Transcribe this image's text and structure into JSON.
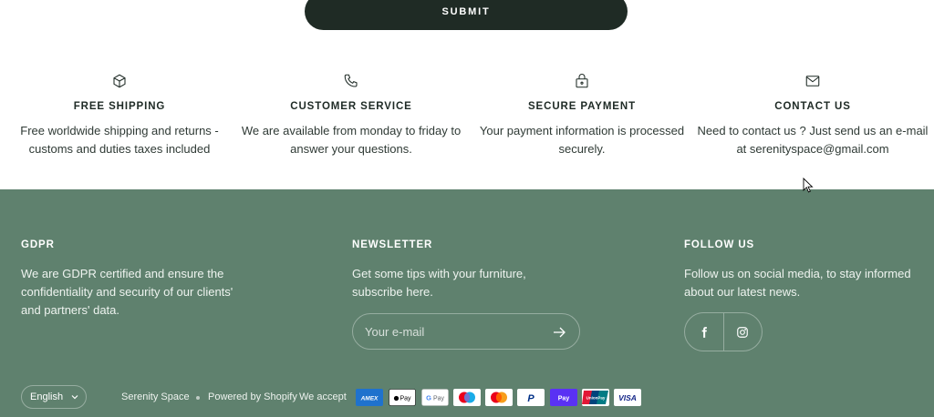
{
  "form": {
    "submit_label": "SUBMIT"
  },
  "features": [
    {
      "icon": "package-icon",
      "title": "FREE SHIPPING",
      "text": "Free worldwide shipping and returns - customs and duties taxes included"
    },
    {
      "icon": "phone-icon",
      "title": "CUSTOMER SERVICE",
      "text": "We are available from monday to friday to answer your questions."
    },
    {
      "icon": "lock-icon",
      "title": "SECURE PAYMENT",
      "text": "Your payment information is processed securely."
    },
    {
      "icon": "mail-icon",
      "title": "CONTACT US",
      "text": "Need to contact us ? Just send us an e-mail at serenityspace@gmail.com"
    }
  ],
  "footer": {
    "background": "#5f816e",
    "gdpr": {
      "title": "GDPR",
      "text": "We are GDPR certified and ensure the confidentiality and security of our clients' and partners' data."
    },
    "newsletter": {
      "title": "NEWSLETTER",
      "text": "Get some tips with your furniture, subscribe here.",
      "email_placeholder": "Your e-mail"
    },
    "follow": {
      "title": "FOLLOW US",
      "text": "Follow us on social media, to stay informed about our latest news.",
      "networks": [
        "facebook-icon",
        "instagram-icon"
      ]
    },
    "language": "English",
    "store_name": "Serenity Space",
    "powered_by": "Powered by Shopify",
    "we_accept": "We accept",
    "payment_methods": [
      "American Express",
      "Apple Pay",
      "Google Pay",
      "Maestro",
      "Mastercard",
      "PayPal",
      "Shop Pay",
      "Union Pay",
      "Visa"
    ]
  }
}
